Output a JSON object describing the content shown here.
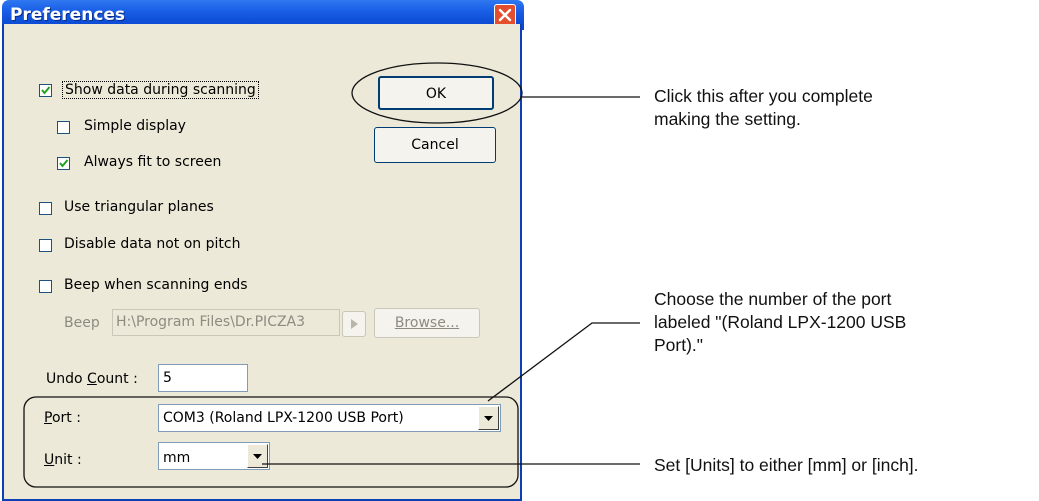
{
  "dialog": {
    "title": "Preferences",
    "ok_label": "OK",
    "cancel_label": "Cancel",
    "checkboxes": [
      {
        "label": "Show data during scanning",
        "checked": true
      },
      {
        "label": "Simple display",
        "checked": false
      },
      {
        "label": "Always fit to screen",
        "checked": true
      },
      {
        "label": "Use triangular planes",
        "checked": false
      },
      {
        "label": "Disable data not on pitch",
        "checked": false
      },
      {
        "label": "Beep when scanning ends",
        "checked": false
      }
    ],
    "beep": {
      "label": "Beep",
      "path": "H:\\Program Files\\Dr.PICZA3",
      "browse_label": "Browse..."
    },
    "undo": {
      "label_pre": "Undo ",
      "label_ul": "C",
      "label_post": "ount :",
      "value": "5"
    },
    "port": {
      "label_ul": "P",
      "label_post": "ort :",
      "value": "COM3 (Roland LPX-1200 USB Port)"
    },
    "unit": {
      "label_ul": "U",
      "label_post": "nit :",
      "value": "mm"
    }
  },
  "annotations": {
    "ok": [
      "Click this after you complete",
      "making the setting."
    ],
    "port": [
      "Choose the number of the port",
      "labeled \"(Roland LPX-1200 USB",
      "Port).\""
    ],
    "unit": [
      "Set [Units] to either [mm] or [inch]."
    ]
  },
  "colors": {
    "titlebar": "#0f4fd8",
    "dialog_bg": "#ece9d8",
    "close_button": "#e34e2d"
  }
}
